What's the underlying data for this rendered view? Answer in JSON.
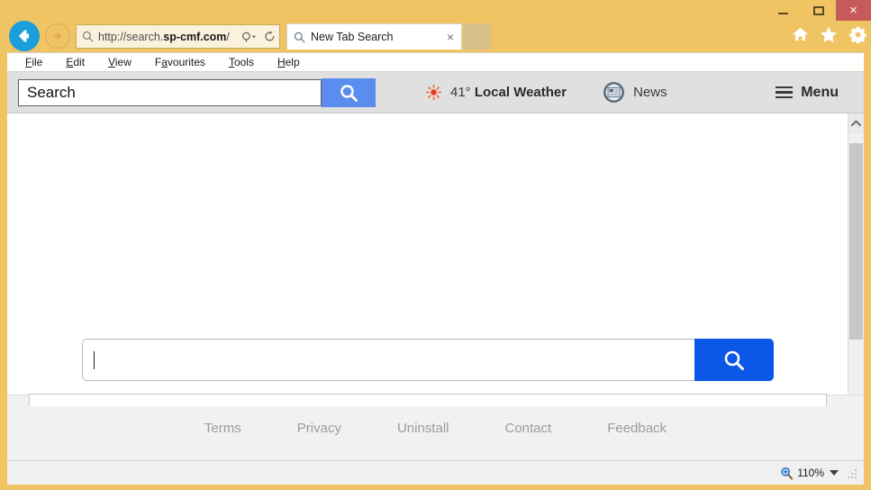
{
  "window": {
    "controls": {
      "minimize": "minimize-button",
      "maximize": "maximize-button",
      "close": "×"
    },
    "chrome_color": "#f0c463",
    "close_color": "#c75b5b"
  },
  "browser": {
    "back_label": "Back",
    "forward_label": "Forward",
    "address": {
      "prefix": "http://search.",
      "domain": "sp-cmf.com",
      "suffix": "/",
      "full": "http://search.sp-cmf.com/"
    },
    "tab": {
      "title": "New Tab Search",
      "close_label": "×"
    },
    "new_tab_label": "",
    "icons": [
      "home-icon",
      "favorites-star-icon",
      "settings-gear-icon"
    ],
    "menubar": [
      {
        "label": "File",
        "accel": "F"
      },
      {
        "label": "Edit",
        "accel": "E"
      },
      {
        "label": "View",
        "accel": "V"
      },
      {
        "label": "Favourites",
        "accel": "a"
      },
      {
        "label": "Tools",
        "accel": "T"
      },
      {
        "label": "Help",
        "accel": "H"
      }
    ]
  },
  "addon_toolbar": {
    "search_placeholder": "Search",
    "search_value": "Search",
    "search_button": "search-icon",
    "weather": {
      "icon": "sun-icon",
      "temperature": "41°",
      "label": "Local Weather"
    },
    "news": {
      "icon": "newspaper-icon",
      "label": "News"
    },
    "menu": {
      "icon": "hamburger-icon",
      "label": "Menu"
    },
    "accent_color": "#5b8def"
  },
  "page": {
    "search": {
      "value": "",
      "placeholder": "",
      "button_icon": "search-icon",
      "button_color": "#0b57e8"
    },
    "footer_links": [
      "Terms",
      "Privacy",
      "Uninstall",
      "Contact",
      "Feedback"
    ]
  },
  "statusbar": {
    "zoom_icon": "zoom-in-icon",
    "zoom_level": "110%",
    "dropdown": "chevron-down-icon",
    "resize_grip": "resize-grip-icon"
  }
}
